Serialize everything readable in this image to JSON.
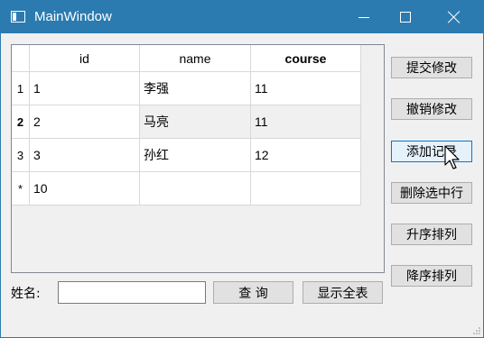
{
  "window": {
    "title": "MainWindow"
  },
  "table": {
    "columns": [
      "id",
      "name",
      "course"
    ],
    "row_headers": [
      "1",
      "2",
      "3",
      "*"
    ],
    "rows": [
      [
        "1",
        "李强",
        "11"
      ],
      [
        "2",
        "马亮",
        "11"
      ],
      [
        "3",
        "孙红",
        "12"
      ],
      [
        "10",
        "",
        ""
      ]
    ]
  },
  "buttons": {
    "commit": "提交修改",
    "revert": "撤销修改",
    "add": "添加记录",
    "delete": "删除选中行",
    "sort_asc": "升序排列",
    "sort_desc": "降序排列",
    "query": "查 询",
    "show_all": "显示全表"
  },
  "search": {
    "label": "姓名:",
    "value": ""
  },
  "colors": {
    "titlebar": "#2b7bb0",
    "focus_border": "#0078d7"
  },
  "icons": {
    "app": "window-icon",
    "cursor": "mouse-pointer-icon"
  }
}
